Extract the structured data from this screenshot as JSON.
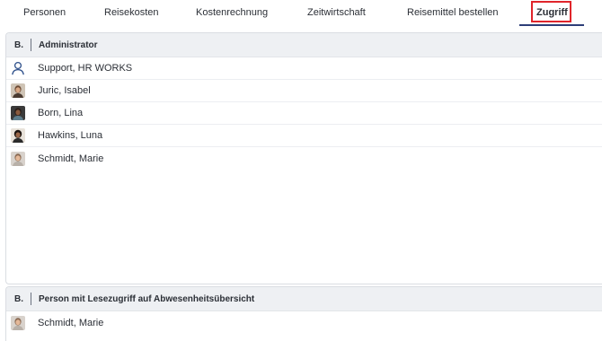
{
  "tabs": [
    {
      "label": "Personen"
    },
    {
      "label": "Reisekosten"
    },
    {
      "label": "Kostenrechnung"
    },
    {
      "label": "Zeitwirtschaft"
    },
    {
      "label": "Reisemittel bestellen"
    },
    {
      "label": "Zugriff",
      "active": true
    }
  ],
  "colors": {
    "active_tab_underline": "#2d3e78",
    "highlight_outline": "#e0252b",
    "header_background": "#eef0f3"
  },
  "sections": [
    {
      "prefix": "B.",
      "title": "Administrator",
      "members": [
        {
          "name": "Support, HR WORKS",
          "icon": "user-outline-icon"
        },
        {
          "name": "Juric, Isabel",
          "icon": "avatar-photo"
        },
        {
          "name": "Born, Lina",
          "icon": "avatar-photo"
        },
        {
          "name": "Hawkins, Luna",
          "icon": "avatar-photo"
        },
        {
          "name": "Schmidt, Marie",
          "icon": "avatar-photo"
        }
      ]
    },
    {
      "prefix": "B.",
      "title": "Person mit Lesezugriff auf Abwesenheitsübersicht",
      "members": [
        {
          "name": "Schmidt, Marie",
          "icon": "avatar-photo"
        }
      ]
    }
  ]
}
